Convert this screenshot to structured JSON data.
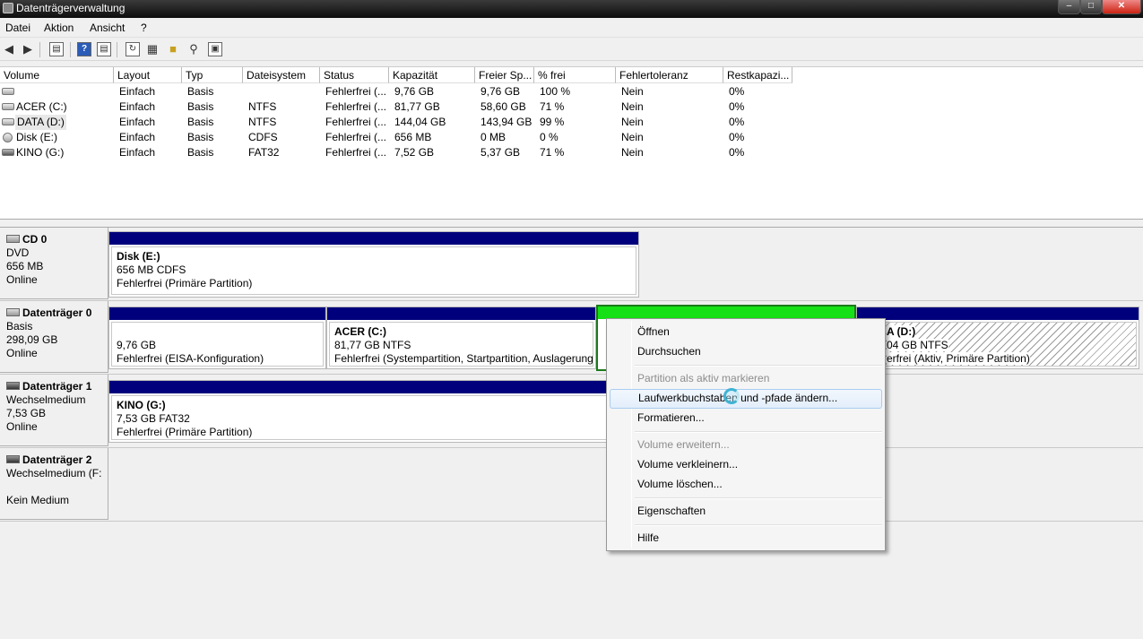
{
  "window": {
    "title": "Datenträgerverwaltung",
    "minimize": "–",
    "maximize": "□",
    "close": "✕"
  },
  "menubar": [
    "Datei",
    "Aktion",
    "Ansicht",
    "?"
  ],
  "toolbar": {
    "icons": [
      "back-icon",
      "forward-icon",
      "console-tree-icon",
      "help-icon",
      "action-pane-icon",
      "refresh-icon",
      "properties-icon",
      "open-folder-icon",
      "search-icon",
      "export-icon"
    ],
    "help_glyph": "?"
  },
  "columns": [
    "Volume",
    "Layout",
    "Typ",
    "Dateisystem",
    "Status",
    "Kapazität",
    "Freier Sp...",
    "% frei",
    "Fehlertoleranz",
    "Restkapazi..."
  ],
  "volumes": [
    {
      "volume": "",
      "layout": "Einfach",
      "typ": "Basis",
      "fs": "",
      "status": "Fehlerfrei (...",
      "cap": "9,76 GB",
      "free": "9,76 GB",
      "pct": "100 %",
      "ft": "Nein",
      "rest": "0%"
    },
    {
      "volume": "ACER (C:)",
      "layout": "Einfach",
      "typ": "Basis",
      "fs": "NTFS",
      "status": "Fehlerfrei (...",
      "cap": "81,77 GB",
      "free": "58,60 GB",
      "pct": "71 %",
      "ft": "Nein",
      "rest": "0%"
    },
    {
      "volume": "DATA (D:)",
      "layout": "Einfach",
      "typ": "Basis",
      "fs": "NTFS",
      "status": "Fehlerfrei (...",
      "cap": "144,04 GB",
      "free": "143,94 GB",
      "pct": "99 %",
      "ft": "Nein",
      "rest": "0%"
    },
    {
      "volume": "Disk (E:)",
      "layout": "Einfach",
      "typ": "Basis",
      "fs": "CDFS",
      "status": "Fehlerfrei (...",
      "cap": "656 MB",
      "free": "0 MB",
      "pct": "0 %",
      "ft": "Nein",
      "rest": "0%"
    },
    {
      "volume": "KINO (G:)",
      "layout": "Einfach",
      "typ": "Basis",
      "fs": "FAT32",
      "status": "Fehlerfrei (...",
      "cap": "7,52 GB",
      "free": "5,37 GB",
      "pct": "71 %",
      "ft": "Nein",
      "rest": "0%"
    }
  ],
  "disks": [
    {
      "name": "CD 0",
      "line1": "DVD",
      "line2": "656 MB",
      "line3": "Online"
    },
    {
      "name": "Datenträger 0",
      "line1": "Basis",
      "line2": "298,09 GB",
      "line3": "Online"
    },
    {
      "name": "Datenträger 1",
      "line1": "Wechselmedium",
      "line2": "7,53 GB",
      "line3": "Online"
    },
    {
      "name": "Datenträger 2",
      "line1": "Wechselmedium (F:",
      "line2": "",
      "line3": "Kein Medium"
    }
  ],
  "partitions": {
    "cd": {
      "title": "Disk  (E:)",
      "size": "656 MB CDFS",
      "status": "Fehlerfrei (Primäre Partition)"
    },
    "eisa": {
      "title": "",
      "size": "9,76 GB",
      "status": "Fehlerfrei (EISA-Konfiguration)"
    },
    "acer": {
      "title": "ACER  (C:)",
      "size": "81,77 GB NTFS",
      "status": "Fehlerfrei (Systempartition, Startpartition, Auslagerung"
    },
    "data": {
      "title": "A  (D:)",
      "size": "04 GB NTFS",
      "status": "erfrei (Aktiv, Primäre Partition)"
    },
    "kino": {
      "title": "KINO  (G:)",
      "size": "7,53 GB FAT32",
      "status": "Fehlerfrei (Primäre Partition)"
    }
  },
  "context_menu": {
    "open": "Öffnen",
    "browse": "Durchsuchen",
    "mark_active": "Partition als aktiv markieren",
    "change_letter": "Laufwerkbuchstaben und -pfade ändern...",
    "format": "Formatieren...",
    "extend": "Volume erweitern...",
    "shrink": "Volume verkleinern...",
    "delete": "Volume löschen...",
    "properties": "Eigenschaften",
    "help": "Hilfe"
  }
}
